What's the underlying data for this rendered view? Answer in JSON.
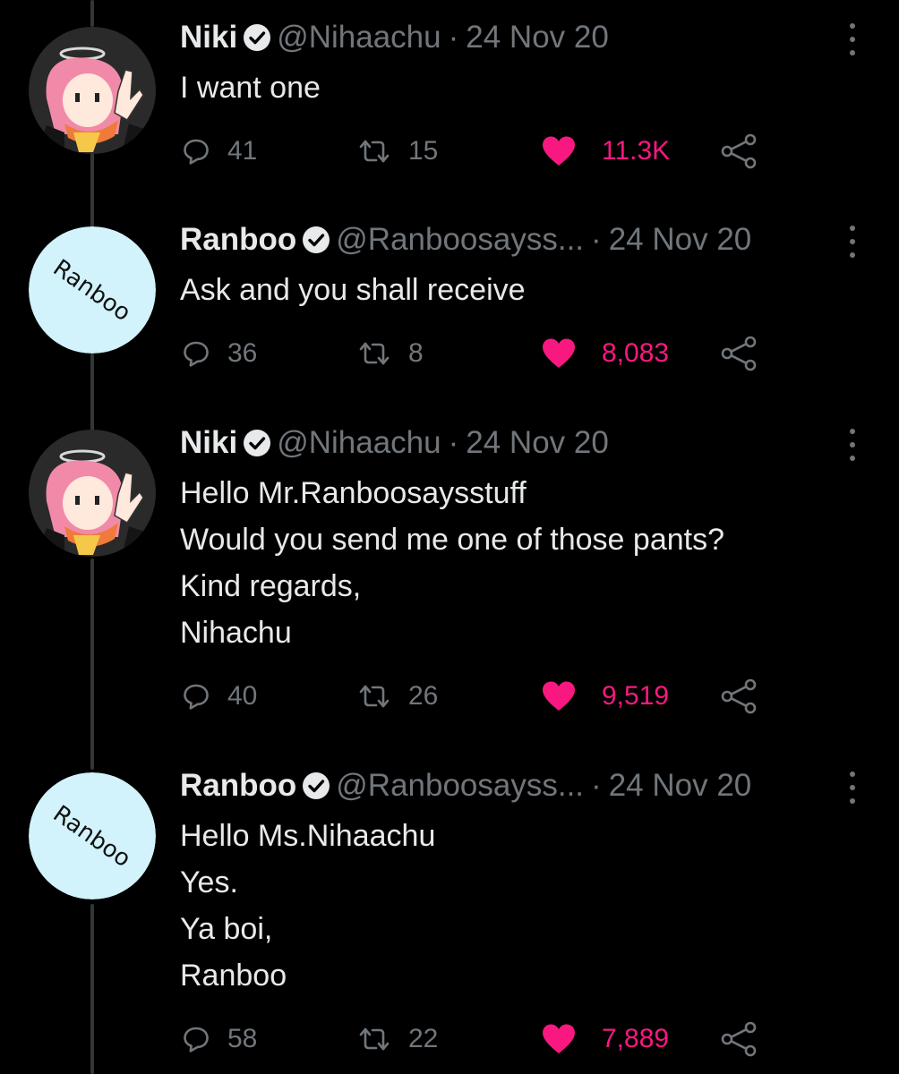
{
  "colors": {
    "background": "#000000",
    "text": "#e7e9ea",
    "muted": "#71767b",
    "like": "#f91880"
  },
  "tweets": [
    {
      "name": "Niki",
      "handle": "@Nihaachu",
      "date": "24 Nov 20",
      "lines": [
        "I want one"
      ],
      "replies": "41",
      "retweets": "15",
      "likes": "11.3K",
      "liked": true,
      "avatar": "niki-avatar"
    },
    {
      "name": "Ranboo",
      "handle": "@Ranboosayss...",
      "date": "24 Nov 20",
      "lines": [
        "Ask and you shall receive"
      ],
      "replies": "36",
      "retweets": "8",
      "likes": "8,083",
      "liked": true,
      "avatar": "ranboo-avatar",
      "avatar_text": "Ranboo"
    },
    {
      "name": "Niki",
      "handle": "@Nihaachu",
      "date": "24 Nov 20",
      "lines": [
        "Hello Mr.Ranboosaysstuff",
        "Would you send me one of those pants?",
        "Kind regards,",
        "Nihachu"
      ],
      "replies": "40",
      "retweets": "26",
      "likes": "9,519",
      "liked": true,
      "avatar": "niki-avatar"
    },
    {
      "name": "Ranboo",
      "handle": "@Ranboosayss...",
      "date": "24 Nov 20",
      "lines": [
        "Hello Ms.Nihaachu",
        "Yes.",
        "Ya boi,",
        "Ranboo"
      ],
      "replies": "58",
      "retweets": "22",
      "likes": "7,889",
      "liked": true,
      "avatar": "ranboo-avatar",
      "avatar_text": "Ranboo"
    }
  ],
  "separator": "·"
}
